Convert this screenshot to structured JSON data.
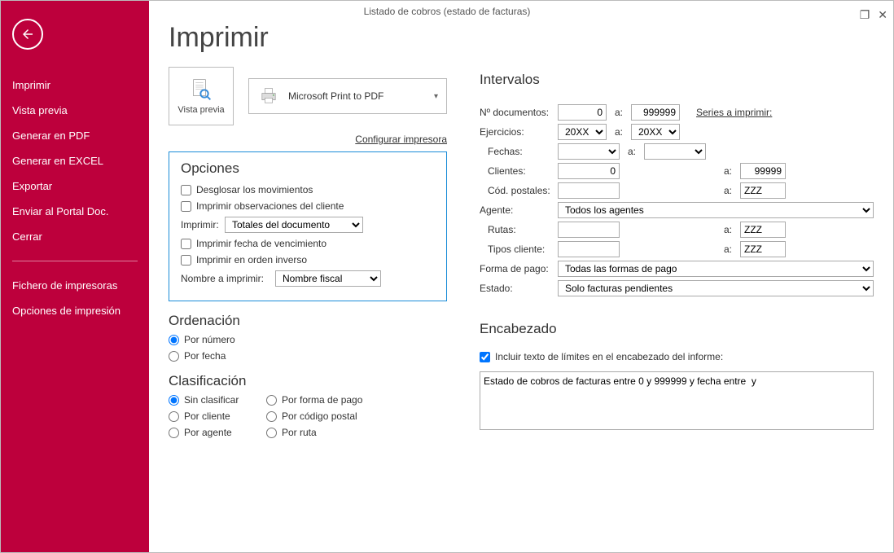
{
  "window": {
    "title": "Listado de cobros (estado de facturas)"
  },
  "sidebar": {
    "items": [
      "Imprimir",
      "Vista previa",
      "Generar en PDF",
      "Generar en EXCEL",
      "Exportar",
      "Enviar al Portal Doc.",
      "Cerrar"
    ],
    "items2": [
      "Fichero de impresoras",
      "Opciones de impresión"
    ]
  },
  "page": {
    "title": "Imprimir"
  },
  "preview_btn": "Vista previa",
  "printer": {
    "name": "Microsoft Print to PDF",
    "configure": "Configurar impresora"
  },
  "opciones": {
    "title": "Opciones",
    "desglosar": "Desglosar los movimientos",
    "obs": "Imprimir observaciones del cliente",
    "imprimir_lbl": "Imprimir:",
    "imprimir_val": "Totales del documento",
    "fecha_venc": "Imprimir fecha de vencimiento",
    "orden_inv": "Imprimir en orden inverso",
    "nombre_lbl": "Nombre a imprimir:",
    "nombre_val": "Nombre fiscal"
  },
  "orden": {
    "title": "Ordenación",
    "numero": "Por número",
    "fecha": "Por fecha"
  },
  "clas": {
    "title": "Clasificación",
    "sin": "Sin clasificar",
    "forma": "Por forma de pago",
    "cliente": "Por cliente",
    "codpostal": "Por código postal",
    "agente": "Por agente",
    "ruta": "Por ruta"
  },
  "intv": {
    "title": "Intervalos",
    "ndoc_lbl": "Nº documentos:",
    "ndoc_from": "0",
    "a": "a:",
    "ndoc_to": "999999",
    "series": "Series a imprimir:",
    "ejerc_lbl": "Ejercicios:",
    "ejerc_from": "20XX",
    "ejerc_to": "20XX",
    "fechas_lbl": "Fechas:",
    "clientes_lbl": "Clientes:",
    "clientes_from": "0",
    "clientes_to": "99999",
    "codpost_lbl": "Cód. postales:",
    "codpost_to": "ZZZ",
    "agente_lbl": "Agente:",
    "agente_val": "Todos los agentes",
    "rutas_lbl": "Rutas:",
    "rutas_to": "ZZZ",
    "tipos_lbl": "Tipos cliente:",
    "tipos_to": "ZZZ",
    "forma_lbl": "Forma de pago:",
    "forma_val": "Todas las formas de pago",
    "estado_lbl": "Estado:",
    "estado_val": "Solo facturas pendientes"
  },
  "encab": {
    "title": "Encabezado",
    "chk": "Incluir texto de límites en el encabezado del informe:",
    "text": "Estado de cobros de facturas entre 0 y 999999 y fecha entre  y"
  }
}
